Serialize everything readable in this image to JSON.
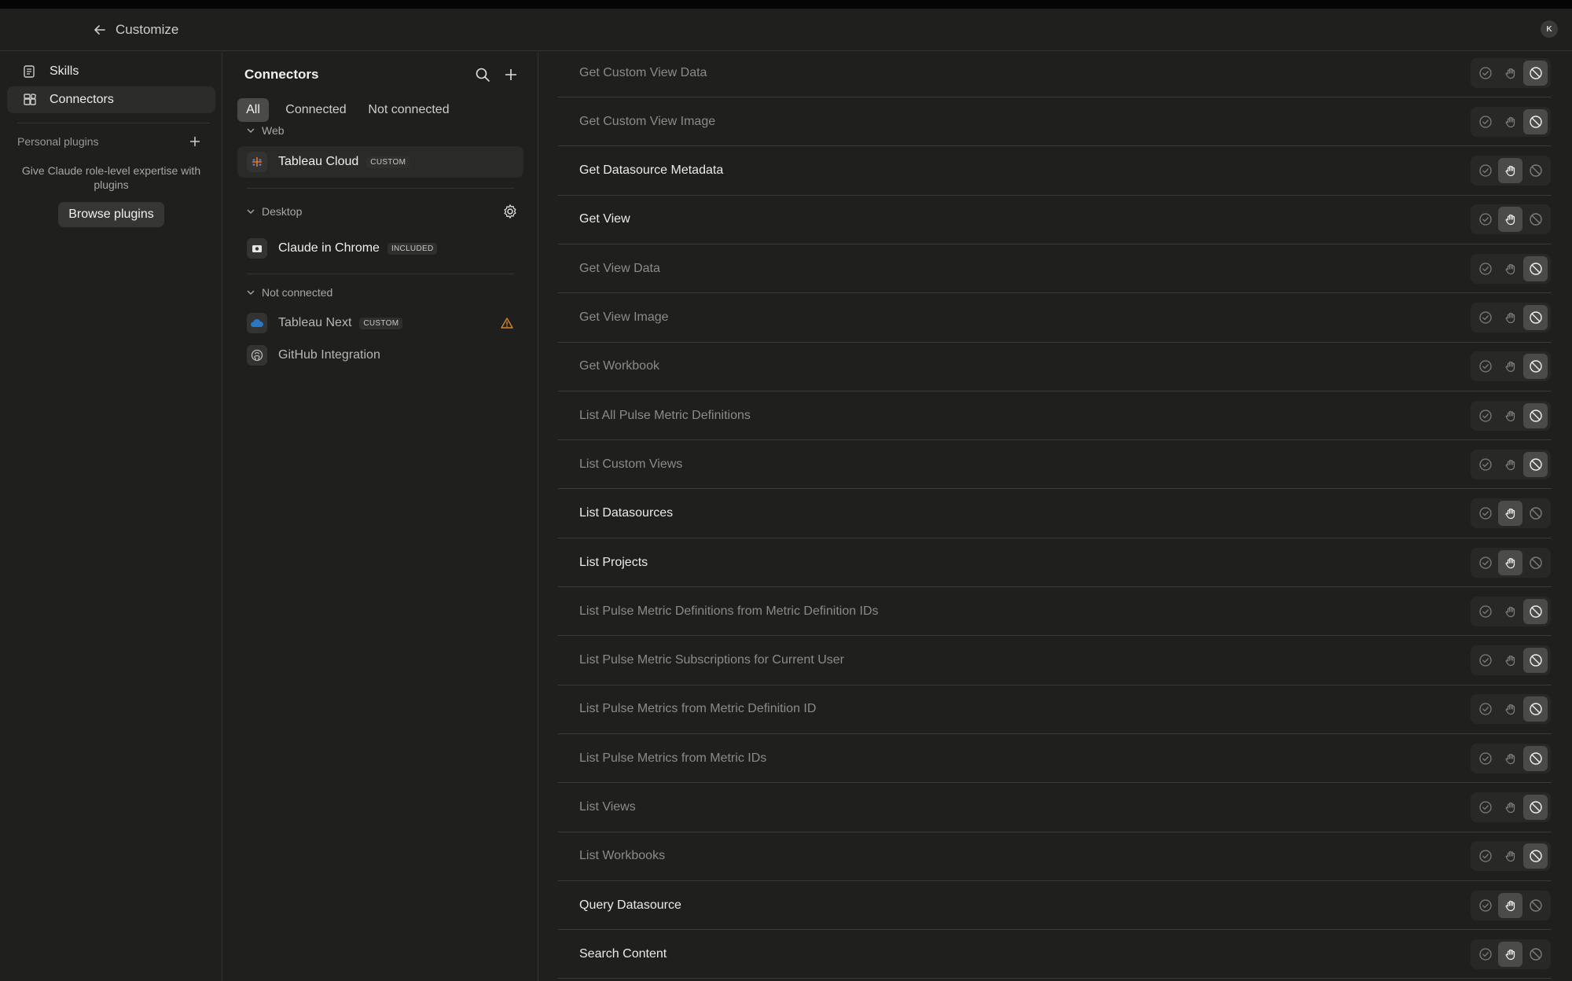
{
  "window": {
    "title": "Customize",
    "avatar_initial": "K"
  },
  "sidebar": {
    "items": [
      {
        "label": "Skills",
        "icon": "skills-icon",
        "active": false
      },
      {
        "label": "Connectors",
        "icon": "connectors-icon",
        "active": true
      }
    ],
    "personal_plugins_label": "Personal plugins",
    "personal_plugins_desc": "Give Claude role-level expertise with plugins",
    "browse_plugins_label": "Browse plugins"
  },
  "connectors": {
    "title": "Connectors",
    "tabs": [
      {
        "label": "All",
        "active": true
      },
      {
        "label": "Connected",
        "active": false
      },
      {
        "label": "Not connected",
        "active": false
      }
    ],
    "groups": {
      "web": "Web",
      "desktop": "Desktop",
      "not_connected": "Not connected"
    },
    "items": {
      "tableau_cloud": {
        "name": "Tableau Cloud",
        "badge": "CUSTOM"
      },
      "claude_chrome": {
        "name": "Claude in Chrome",
        "badge": "INCLUDED"
      },
      "tableau_next": {
        "name": "Tableau Next",
        "badge": "CUSTOM"
      },
      "github": {
        "name": "GitHub Integration"
      }
    }
  },
  "tools": [
    {
      "name": "Get Custom View Data",
      "permission": "block"
    },
    {
      "name": "Get Custom View Image",
      "permission": "block"
    },
    {
      "name": "Get Datasource Metadata",
      "permission": "ask"
    },
    {
      "name": "Get View",
      "permission": "ask"
    },
    {
      "name": "Get View Data",
      "permission": "block"
    },
    {
      "name": "Get View Image",
      "permission": "block"
    },
    {
      "name": "Get Workbook",
      "permission": "block"
    },
    {
      "name": "List All Pulse Metric Definitions",
      "permission": "block"
    },
    {
      "name": "List Custom Views",
      "permission": "block"
    },
    {
      "name": "List Datasources",
      "permission": "ask"
    },
    {
      "name": "List Projects",
      "permission": "ask"
    },
    {
      "name": "List Pulse Metric Definitions from Metric Definition IDs",
      "permission": "block"
    },
    {
      "name": "List Pulse Metric Subscriptions for Current User",
      "permission": "block"
    },
    {
      "name": "List Pulse Metrics from Metric Definition ID",
      "permission": "block"
    },
    {
      "name": "List Pulse Metrics from Metric IDs",
      "permission": "block"
    },
    {
      "name": "List Views",
      "permission": "block"
    },
    {
      "name": "List Workbooks",
      "permission": "block"
    },
    {
      "name": "Query Datasource",
      "permission": "ask"
    },
    {
      "name": "Search Content",
      "permission": "ask"
    }
  ],
  "colors": {
    "background": "#1f1f1e",
    "selected_segment": "#4b4b49",
    "warning": "#d9822b"
  }
}
